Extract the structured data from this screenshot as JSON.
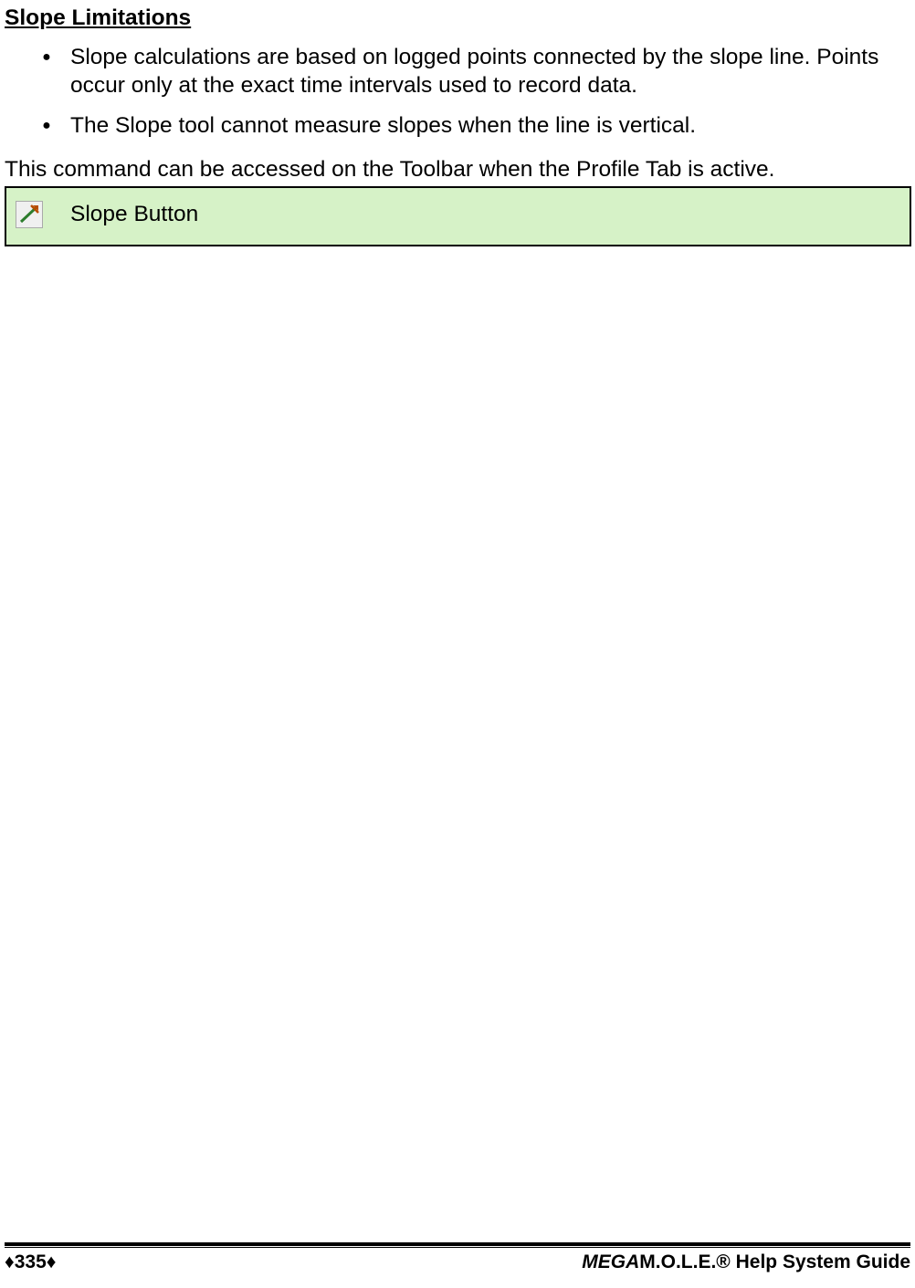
{
  "heading": "Slope Limitations",
  "bullets": [
    "Slope calculations are based on logged points connected by the slope line. Points occur only at the exact time intervals used to record data.",
    "The Slope tool cannot measure slopes when the line is vertical."
  ],
  "access_text": "This command can be accessed on the Toolbar when the Profile Tab is active.",
  "button_label": "Slope Button",
  "footer": {
    "page_marker": "♦335♦",
    "guide_prefix": "MEGA",
    "guide_suffix": "M.O.L.E.® Help System Guide"
  }
}
